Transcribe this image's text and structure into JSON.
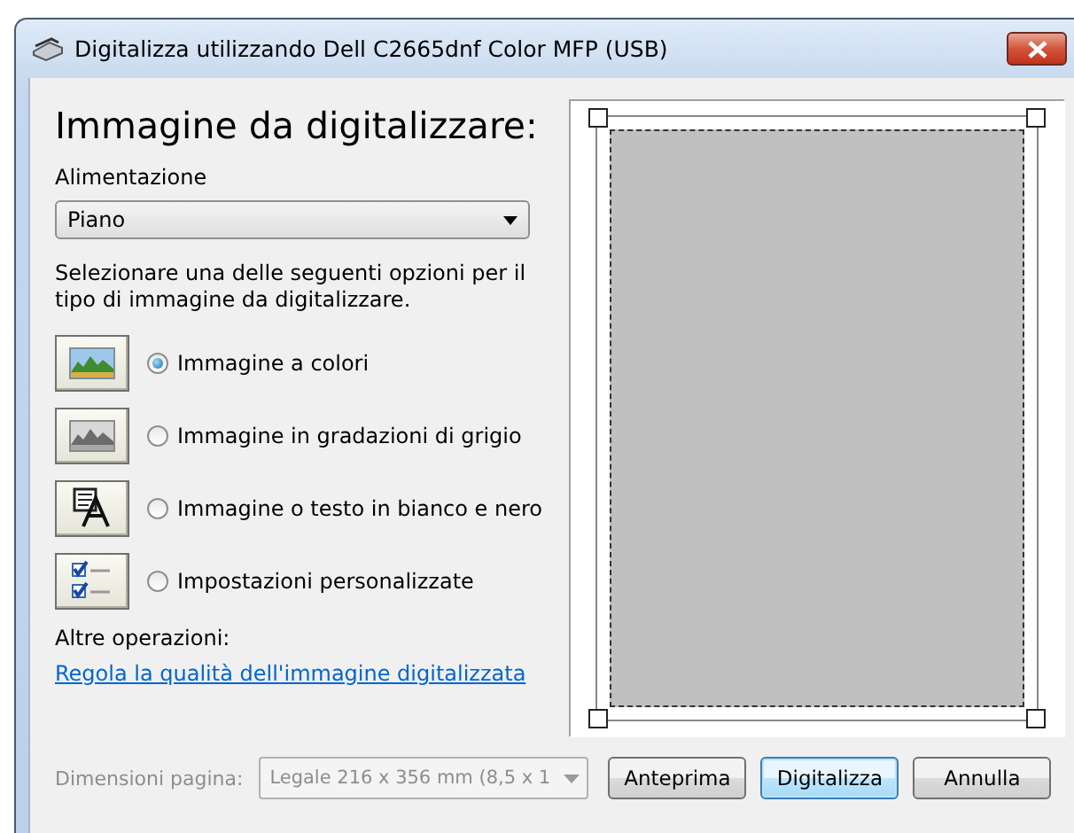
{
  "window": {
    "title": "Digitalizza utilizzando Dell C2665dnf Color MFP (USB)"
  },
  "heading": "Immagine da digitalizzare:",
  "source": {
    "label": "Alimentazione",
    "value": "Piano"
  },
  "instructions": "Selezionare una delle seguenti opzioni per il tipo di immagine da digitalizzare.",
  "options": [
    {
      "kind": "color",
      "label": "Immagine a colori",
      "selected": true
    },
    {
      "kind": "grayscale",
      "label": "Immagine in gradazioni di grigio",
      "selected": false
    },
    {
      "kind": "text",
      "label": "Immagine o testo in bianco e nero",
      "selected": false
    },
    {
      "kind": "custom",
      "label": "Impostazioni personalizzate",
      "selected": false
    }
  ],
  "other": {
    "label": "Altre operazioni:",
    "link": "Regola la qualità dell'immagine digitalizzata"
  },
  "page_size": {
    "label": "Dimensioni pagina:",
    "value": "Legale 216 x 356 mm (8,5 x 1",
    "disabled": true
  },
  "buttons": [
    {
      "label": "Anteprima",
      "default": false
    },
    {
      "label": "Digitalizza",
      "default": true
    },
    {
      "label": "Annulla",
      "default": false
    }
  ]
}
